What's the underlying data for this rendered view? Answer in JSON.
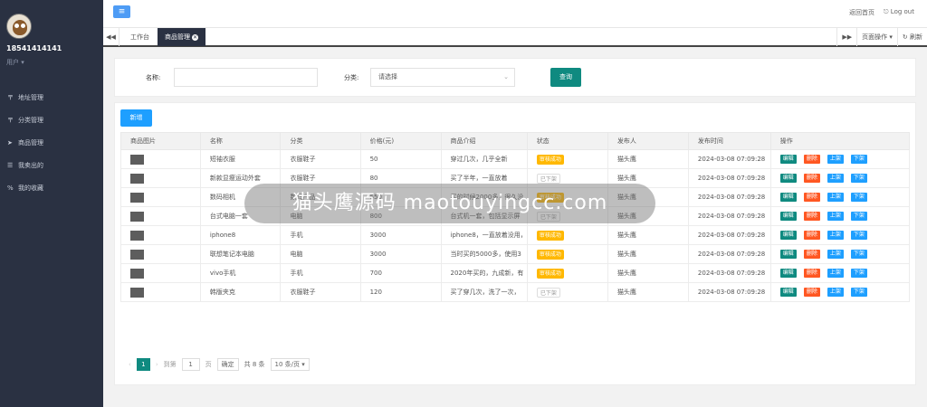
{
  "user": {
    "name": "18541414141",
    "role": "用户 ▾"
  },
  "sidebar": {
    "items": [
      {
        "label": "地址管理",
        "icon": "crosshair-icon"
      },
      {
        "label": "分类管理",
        "icon": "crosshair-icon"
      },
      {
        "label": "商品管理",
        "icon": "paper-plane-icon"
      },
      {
        "label": "我卖出的",
        "icon": "list-icon"
      },
      {
        "label": "我的收藏",
        "icon": "link-icon"
      }
    ]
  },
  "topbar": {
    "home": "返回首页",
    "logout": "Log out"
  },
  "tabs": {
    "items": [
      {
        "label": "工作台"
      },
      {
        "label": "商品管理"
      }
    ],
    "page_ops": "页面操作 ▾",
    "refresh": "刷新"
  },
  "search": {
    "name_label": "名称:",
    "name_value": "",
    "cat_label": "分类:",
    "cat_value": "请选择",
    "query_btn": "查询"
  },
  "add_btn": "新增",
  "table": {
    "headers": [
      "商品图片",
      "名称",
      "分类",
      "价格(元)",
      "商品介绍",
      "状态",
      "发布人",
      "发布时间",
      "操作"
    ],
    "rows": [
      {
        "name": "短袖衣服",
        "cat": "衣服鞋子",
        "price": "50",
        "intro": "穿过几次，几乎全新",
        "status": "审核成功",
        "status_ok": true,
        "user": "猫头鹰",
        "time": "2024-03-08 07:09:28"
      },
      {
        "name": "新款显瘦运动外套",
        "cat": "衣服鞋子",
        "price": "80",
        "intro": "买了半年，一直放着",
        "status": "已下架",
        "status_ok": false,
        "user": "猫头鹰",
        "time": "2024-03-08 07:09:28"
      },
      {
        "name": "数码相机",
        "cat": "数码产品",
        "price": "550",
        "intro": "买的时候2000多，很久没",
        "status": "审核成功",
        "status_ok": true,
        "user": "猫头鹰",
        "time": "2024-03-08 07:09:28"
      },
      {
        "name": "台式电脑一套",
        "cat": "电脑",
        "price": "800",
        "intro": "台式机一套，包括显示屏",
        "status": "已下架",
        "status_ok": false,
        "user": "猫头鹰",
        "time": "2024-03-08 07:09:28"
      },
      {
        "name": "iphone8",
        "cat": "手机",
        "price": "3000",
        "intro": "iphone8，一直放着没用，",
        "status": "审核成功",
        "status_ok": true,
        "user": "猫头鹰",
        "time": "2024-03-08 07:09:28"
      },
      {
        "name": "联想笔记本电脑",
        "cat": "电脑",
        "price": "3000",
        "intro": "当时买的5000多，使用3",
        "status": "审核成功",
        "status_ok": true,
        "user": "猫头鹰",
        "time": "2024-03-08 07:09:28"
      },
      {
        "name": "vivo手机",
        "cat": "手机",
        "price": "700",
        "intro": "2020年买的，九成新，有",
        "status": "审核成功",
        "status_ok": true,
        "user": "猫头鹰",
        "time": "2024-03-08 07:09:28"
      },
      {
        "name": "韩版夹克",
        "cat": "衣服鞋子",
        "price": "120",
        "intro": "买了穿几次，洗了一次，",
        "status": "已下架",
        "status_ok": false,
        "user": "猫头鹰",
        "time": "2024-03-08 07:09:28"
      }
    ],
    "ops": {
      "edit": "编辑",
      "del": "删除",
      "on": "上架",
      "off": "下架"
    }
  },
  "pager": {
    "prev": "‹",
    "current": "1",
    "next": "›",
    "goto": "到第",
    "page_input": "1",
    "page_unit": "页",
    "confirm": "确定",
    "total": "共 8 条",
    "per_page": "10 条/页 ▾"
  },
  "watermark": "猫头鹰源码 maotouyingcc.com",
  "colors": {
    "sidebar": "#2a3142",
    "primary": "#0f8a80",
    "blue": "#1e9fff",
    "warn": "#ffb800",
    "danger": "#ff5722"
  }
}
